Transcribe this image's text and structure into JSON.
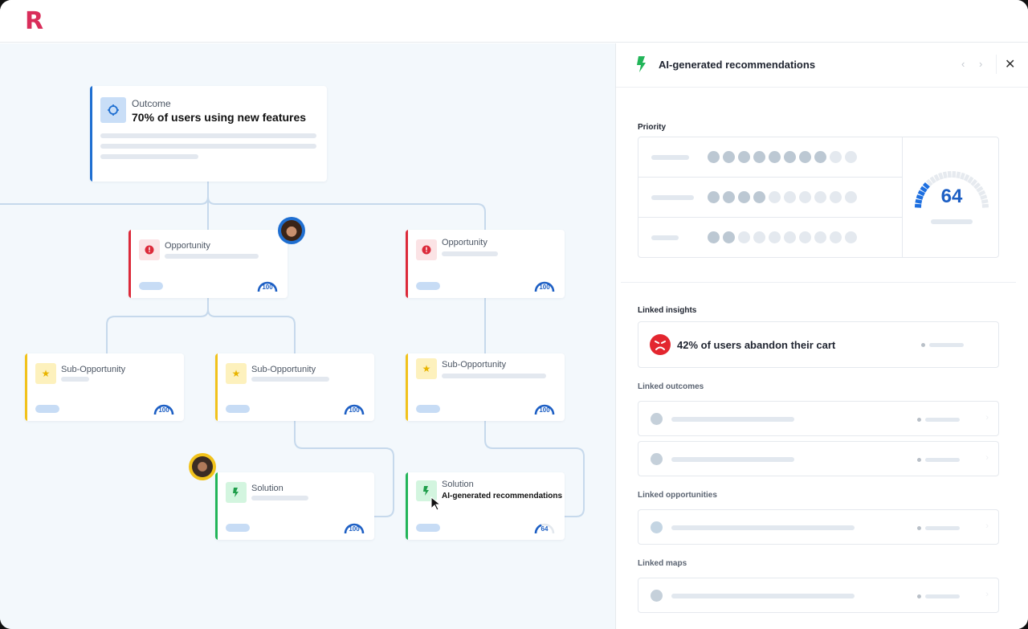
{
  "app": {
    "logo_letter": "R",
    "brand_color": "#d92d5a"
  },
  "tree": {
    "outcome": {
      "kind": "Outcome",
      "title": "70% of users using new features",
      "icon": "target-icon",
      "color": "#1f6fd1"
    },
    "opportunities": [
      {
        "kind": "Opportunity",
        "icon": "alert-icon",
        "score": "100",
        "score_fraction": 1.0,
        "has_avatar": true
      },
      {
        "kind": "Opportunity",
        "icon": "alert-icon",
        "score": "100",
        "score_fraction": 1.0,
        "has_avatar": false
      }
    ],
    "sub_opportunities": [
      {
        "kind": "Sub-Opportunity",
        "icon": "star-icon",
        "score": "100",
        "score_fraction": 1.0
      },
      {
        "kind": "Sub-Opportunity",
        "icon": "star-icon",
        "score": "100",
        "score_fraction": 1.0
      },
      {
        "kind": "Sub-Opportunity",
        "icon": "star-icon",
        "score": "100",
        "score_fraction": 1.0
      }
    ],
    "solutions": [
      {
        "kind": "Solution",
        "subtitle": "",
        "icon": "bolt-icon",
        "score": "100",
        "score_fraction": 1.0,
        "has_avatar": true
      },
      {
        "kind": "Solution",
        "subtitle": "AI-generated recommendations",
        "icon": "bolt-icon",
        "score": "64",
        "score_fraction": 0.64,
        "has_avatar": false
      }
    ],
    "colors": {
      "outcome": "#1f6fd1",
      "opportunity": "#dc2a3a",
      "sub_opportunity": "#f1c21b",
      "solution": "#22b559"
    }
  },
  "panel": {
    "title": "AI-generated recommendations",
    "icon": "bolt-icon",
    "nav_prev": "‹",
    "nav_next": "›",
    "close": "✕",
    "priority": {
      "label": "Priority",
      "rows": [
        {
          "filled": 8,
          "total": 10
        },
        {
          "filled": 4,
          "total": 10
        },
        {
          "filled": 2,
          "total": 10
        }
      ],
      "score": "64",
      "gauge_filled_segments": 6,
      "gauge_total_segments": 24
    },
    "linked_insights": {
      "label": "Linked insights",
      "items": [
        {
          "text": "42% of users abandon their cart",
          "icon": "angry-face-icon"
        }
      ]
    },
    "linked_outcomes": {
      "label": "Linked outcomes",
      "count": 2
    },
    "linked_opportunities": {
      "label": "Linked opportunities",
      "count": 1
    },
    "linked_maps": {
      "label": "Linked maps",
      "count": 1
    }
  }
}
